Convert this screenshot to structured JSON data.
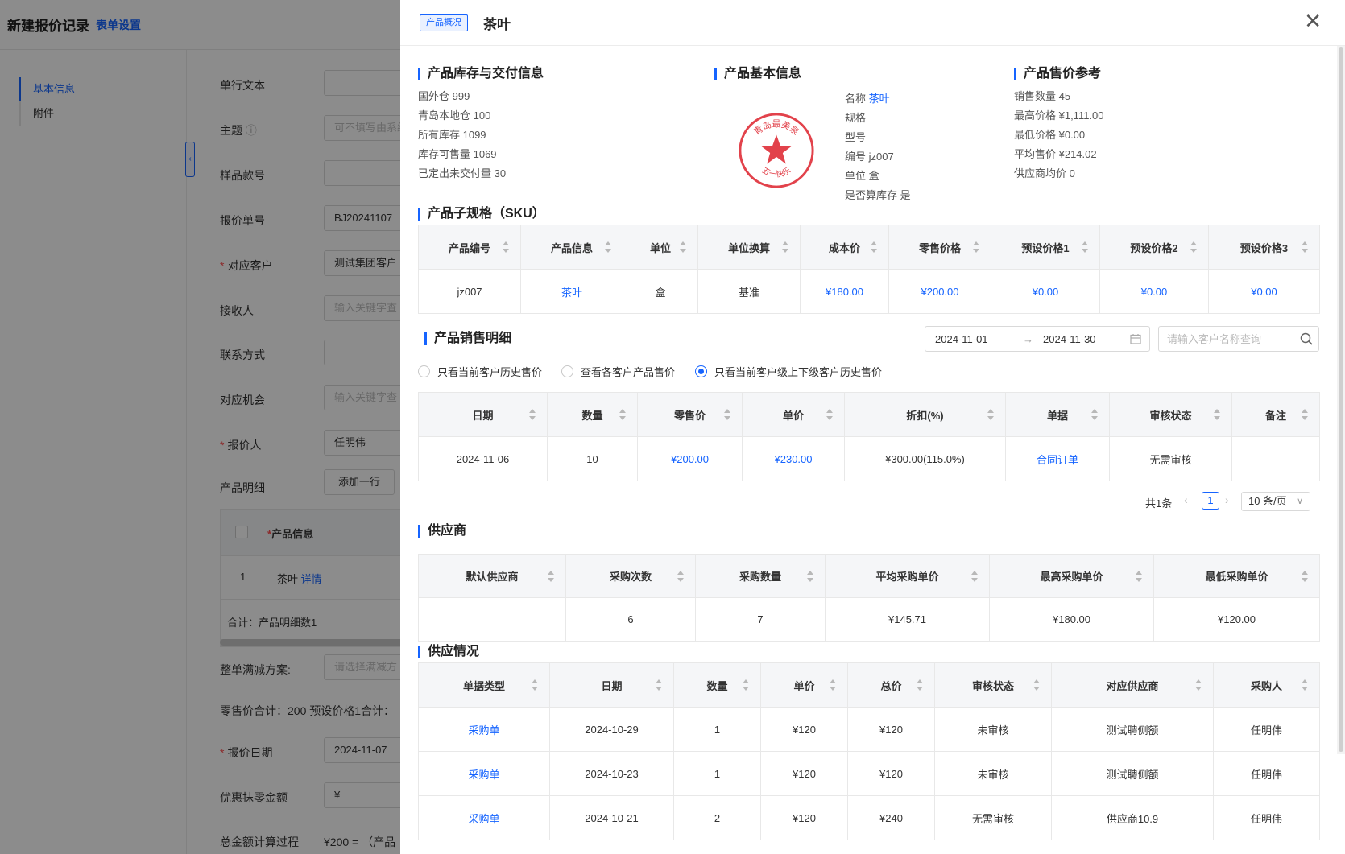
{
  "background": {
    "title": "新建报价记录",
    "form_settings_link": "表单设置",
    "nav": [
      "基本信息",
      "附件"
    ],
    "collapse_glyph": "‹",
    "fields": [
      {
        "label": "单行文本",
        "required": false,
        "value": "",
        "placeholder": ""
      },
      {
        "label": "主题",
        "required": false,
        "value": "",
        "placeholder": "可不填写由系统"
      },
      {
        "label": "样品款号",
        "required": false,
        "value": "",
        "placeholder": ""
      },
      {
        "label": "报价单号",
        "required": false,
        "value": "BJ20241107",
        "placeholder": ""
      },
      {
        "label": "对应客户",
        "required": true,
        "value": "测试集团客户",
        "placeholder": ""
      },
      {
        "label": "接收人",
        "required": false,
        "value": "",
        "placeholder": "输入关键字查"
      },
      {
        "label": "联系方式",
        "required": false,
        "value": "",
        "placeholder": ""
      },
      {
        "label": "对应机会",
        "required": false,
        "value": "",
        "placeholder": "输入关键字查"
      },
      {
        "label": "报价人",
        "required": true,
        "value": "任明伟",
        "placeholder": ""
      }
    ],
    "product_detail_label": "产品明细",
    "add_row_button": "添加一行",
    "product_table": {
      "header": "产品信息",
      "row_index": "1",
      "row_product": "茶叶",
      "row_detail_link": "详情",
      "summary": "合计：产品明细数1"
    },
    "discount_label": "整单满减方案:",
    "discount_placeholder": "请选择满减方",
    "retail_total_text": "零售价合计：200  预设价格1合计：",
    "quote_date_label": "报价日期",
    "quote_date_value": "2024-11-07",
    "rounding_label": "优惠抹零金额",
    "rounding_value": "¥",
    "calc_label": "总金额计算过程",
    "calc_value": "¥200 = （产品"
  },
  "drawer": {
    "tag": "产品概况",
    "title": "茶叶",
    "close_glyph": "✕",
    "inventory": {
      "title": "产品库存与交付信息",
      "items": [
        "国外仓  999",
        "青岛本地仓  100",
        "所有库存  1099",
        "库存可售量  1069",
        "已定出未交付量  30"
      ]
    },
    "basic": {
      "title": "产品基本信息",
      "name_label": "名称",
      "name_value": "茶叶",
      "items": [
        "规格",
        "型号",
        "编号 jz007",
        "单位 盒",
        "是否算库存 是"
      ],
      "seal_top_text": "青岛最美泉",
      "seal_bottom_text": "五一快乐"
    },
    "price_ref": {
      "title": "产品售价参考",
      "items": [
        "销售数量 45",
        "最高价格 ¥1,111.00",
        "最低价格 ¥0.00",
        "平均售价 ¥214.02",
        "供应商均价 0"
      ]
    },
    "sku": {
      "title": "产品子规格（SKU）",
      "headers": [
        "产品编号",
        "产品信息",
        "单位",
        "单位换算",
        "成本价",
        "零售价格",
        "预设价格1",
        "预设价格2",
        "预设价格3"
      ],
      "rows": [
        [
          "jz007",
          "茶叶",
          "盒",
          "基准",
          "¥180.00",
          "¥200.00",
          "¥0.00",
          "¥0.00",
          "¥0.00"
        ]
      ]
    },
    "sales": {
      "title": "产品销售明细",
      "date_start": "2024-11-01",
      "date_end": "2024-11-30",
      "date_arrow": "→",
      "search_placeholder": "请输入客户名称查询",
      "radios": [
        "只看当前客户历史售价",
        "查看各客户产品售价",
        "只看当前客户级上下级客户历史售价"
      ],
      "radio_selected": 2,
      "headers": [
        "日期",
        "数量",
        "零售价",
        "单价",
        "折扣(%)",
        "单据",
        "审核状态",
        "备注"
      ],
      "rows": [
        [
          "2024-11-06",
          "10",
          "¥200.00",
          "¥230.00",
          "¥300.00(115.0%)",
          "合同订单",
          "无需审核",
          ""
        ]
      ],
      "pager_total": "共1条",
      "pager_prev": "‹",
      "pager_page": "1",
      "pager_next": "›",
      "pager_size": "10 条/页",
      "pager_size_arrow": "∨"
    },
    "supplier": {
      "title": "供应商",
      "headers": [
        "默认供应商",
        "采购次数",
        "采购数量",
        "平均采购单价",
        "最高采购单价",
        "最低采购单价"
      ],
      "rows": [
        [
          "",
          "6",
          "7",
          "¥145.71",
          "¥180.00",
          "¥120.00"
        ]
      ]
    },
    "supply": {
      "title": "供应情况",
      "headers": [
        "单据类型",
        "日期",
        "数量",
        "单价",
        "总价",
        "审核状态",
        "对应供应商",
        "采购人"
      ],
      "rows": [
        [
          "采购单",
          "2024-10-29",
          "1",
          "¥120",
          "¥120",
          "未审核",
          "测试聘侧额",
          "任明伟"
        ],
        [
          "采购单",
          "2024-10-23",
          "1",
          "¥120",
          "¥120",
          "未审核",
          "测试聘侧额",
          "任明伟"
        ],
        [
          "采购单",
          "2024-10-21",
          "2",
          "¥120",
          "¥240",
          "无需审核",
          "供应商10.9",
          "任明伟"
        ]
      ]
    }
  },
  "colors": {
    "accent": "#1664ff",
    "seal": "#e2424b",
    "mask": "rgba(0,0,0,0.45)"
  }
}
